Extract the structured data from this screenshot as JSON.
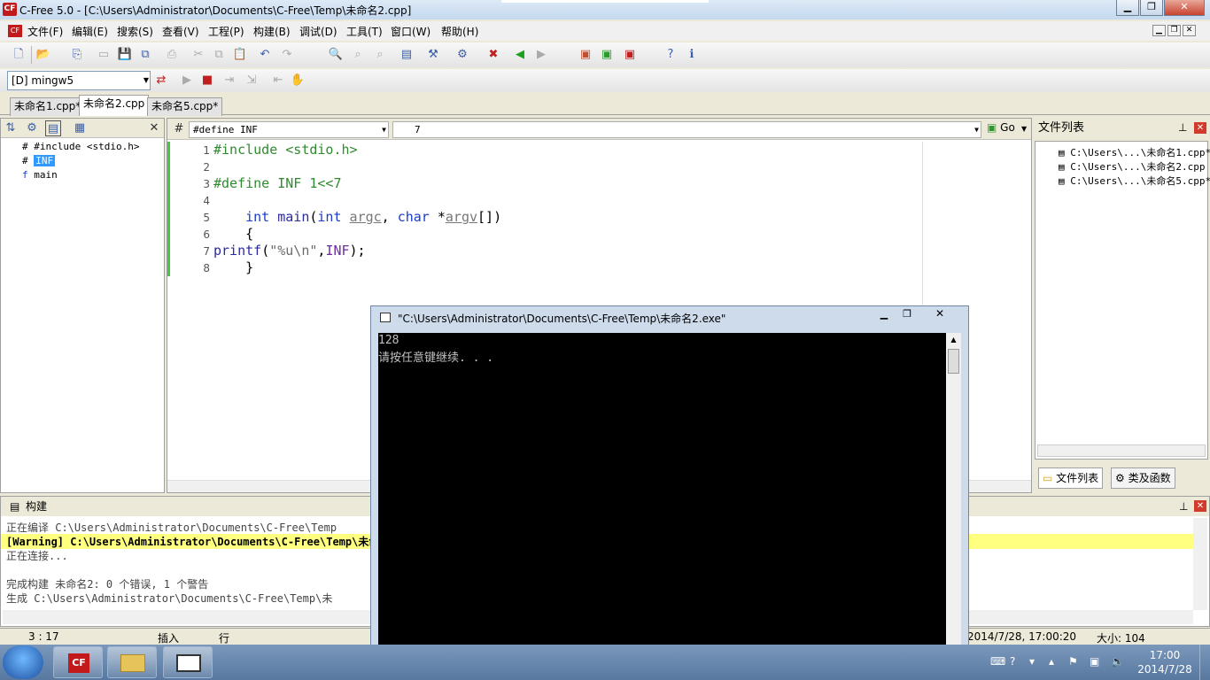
{
  "window": {
    "title": "C-Free 5.0 - [C:\\Users\\Administrator\\Documents\\C-Free\\Temp\\未命名2.cpp]",
    "icon": "CF"
  },
  "menu": [
    "文件(F)",
    "编辑(E)",
    "搜索(S)",
    "查看(V)",
    "工程(P)",
    "构建(B)",
    "调试(D)",
    "工具(T)",
    "窗口(W)",
    "帮助(H)"
  ],
  "toolbar": {
    "compiler": "[D] mingw5"
  },
  "file_tabs": [
    "未命名1.cpp*",
    "未命名2.cpp",
    "未命名5.cpp*"
  ],
  "symbols": {
    "include": "#include <stdio.h>",
    "define": "INF",
    "func": "main"
  },
  "editor": {
    "symbol_combo": "#define INF",
    "line_combo": "7",
    "go": "Go",
    "line_numbers": [
      "1",
      "2",
      "3",
      "4",
      "5",
      "6",
      "7",
      "8"
    ]
  },
  "file_list": {
    "title": "文件列表",
    "items": [
      "C:\\Users\\...\\未命名1.cpp*",
      "C:\\Users\\...\\未命名2.cpp",
      "C:\\Users\\...\\未命名5.cpp*"
    ],
    "tab_files": "文件列表",
    "tab_classes": "类及函数"
  },
  "build": {
    "title": "构建",
    "lines": [
      "正在编译 C:\\Users\\Administrator\\Documents\\C-Free\\Temp",
      "[Warning] C:\\Users\\Administrator\\Documents\\C-Free\\Temp\\未命",
      "正在连接...",
      "",
      "完成构建 未命名2: 0 个错误, 1 个警告",
      "生成 C:\\Users\\Administrator\\Documents\\C-Free\\Temp\\未"
    ]
  },
  "status": {
    "pos": "3 : 17",
    "mode": "插入",
    "line": "行",
    "time": "2014/7/28, 17:00:20",
    "size": "大小: 104"
  },
  "console": {
    "title": "\"C:\\Users\\Administrator\\Documents\\C-Free\\Temp\\未命名2.exe\"",
    "output": [
      "128",
      "请按任意键继续. . ."
    ]
  },
  "taskbar": {
    "time": "17:00",
    "date": "2014/7/28"
  }
}
